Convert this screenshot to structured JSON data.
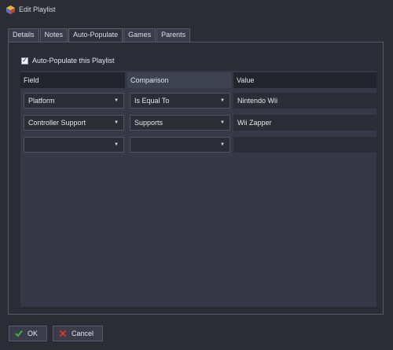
{
  "window": {
    "title": "Edit Playlist"
  },
  "tabs": [
    {
      "label": "Details"
    },
    {
      "label": "Notes"
    },
    {
      "label": "Auto-Populate",
      "active": true
    },
    {
      "label": "Games"
    },
    {
      "label": "Parents"
    }
  ],
  "auto_populate": {
    "checkbox_label": "Auto-Populate this Playlist",
    "checked": true
  },
  "grid": {
    "columns": [
      "Field",
      "Comparison",
      "Value"
    ],
    "rows": [
      {
        "field": "Platform",
        "comparison": "Is Equal To",
        "value": "Nintendo Wii"
      },
      {
        "field": "Controller Support",
        "comparison": "Supports",
        "value": "Wii Zapper"
      },
      {
        "field": "",
        "comparison": "",
        "value": ""
      }
    ]
  },
  "buttons": {
    "ok": "OK",
    "cancel": "Cancel"
  },
  "icons": {
    "app": "launchbox-icon",
    "ok": "checkmark-icon",
    "cancel": "x-icon",
    "dropdown": "chevron-down-icon"
  },
  "colors": {
    "ok_check": "#3bb54a",
    "cancel_x": "#d23434"
  }
}
